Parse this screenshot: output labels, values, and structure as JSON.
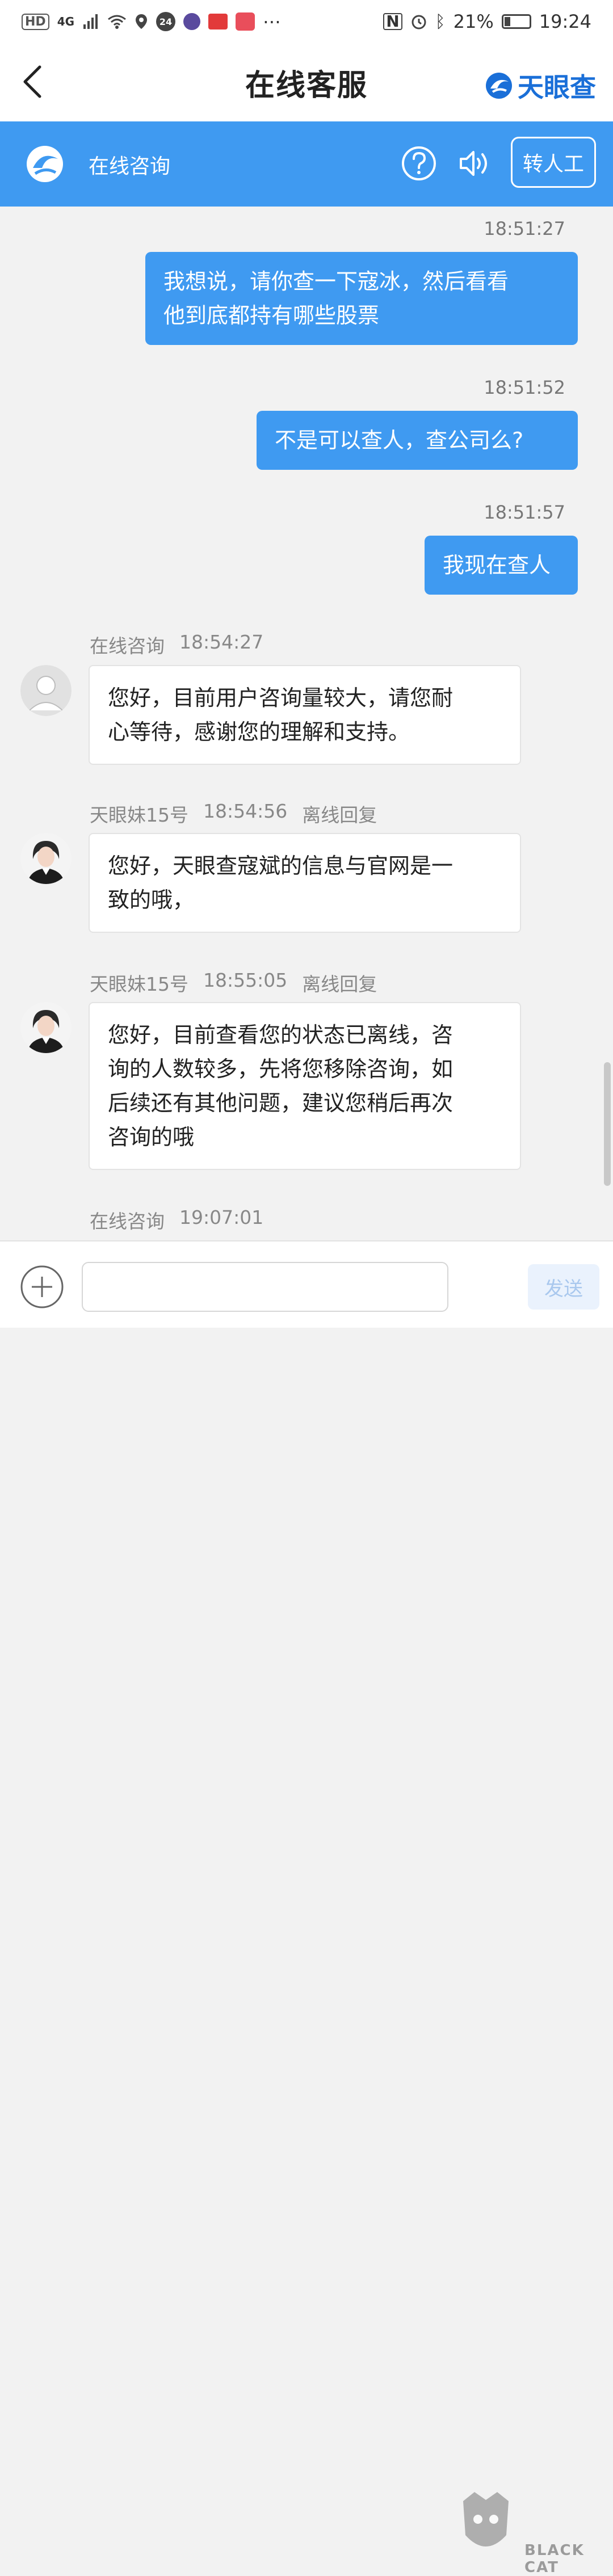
{
  "status_bar": {
    "left_chip": "HD",
    "network": "4G",
    "time_badge": "24",
    "battery": "21%",
    "time": "19:24"
  },
  "header": {
    "title": "在线客服",
    "brand": "天眼查"
  },
  "subbar": {
    "title": "在线咨询",
    "transfer_label": "转人工",
    "bg_color": "#3f9af1"
  },
  "messages": [
    {
      "side": "out",
      "time": "18:51:27",
      "text_lines": [
        "我想说，请你查一下寇冰，然后看看",
        "他到底都持有哪些股票"
      ]
    },
    {
      "side": "out",
      "time": "18:51:52",
      "text_lines": [
        "不是可以查人，查公司么?"
      ]
    },
    {
      "side": "out",
      "time": "18:51:57",
      "text_lines": [
        "我现在查人"
      ]
    },
    {
      "side": "in",
      "sender": "在线咨询",
      "time": "18:54:27",
      "tag": "",
      "avatar": "default-avatar-icon",
      "text_lines": [
        "您好，目前用户咨询量较大，请您耐",
        "心等待，感谢您的理解和支持。"
      ]
    },
    {
      "side": "in",
      "sender": "天眼妹15号",
      "time": "18:54:56",
      "tag": "离线回复",
      "avatar": "agent-avatar",
      "text_lines": [
        "您好，天眼查寇斌的信息与官网是一",
        "致的哦，"
      ]
    },
    {
      "side": "in",
      "sender": "天眼妹15号",
      "time": "18:55:05",
      "tag": "离线回复",
      "avatar": "agent-avatar",
      "text_lines": [
        "您好，目前查看您的状态已离线，咨",
        "询的人数较多，先将您移除咨询，如",
        "后续还有其他问题，建议您稍后再次",
        "咨询的哦"
      ]
    },
    {
      "side": "in",
      "sender": "在线咨询",
      "time": "19:07:01",
      "tag": ""
    }
  ],
  "input": {
    "value": "",
    "placeholder": "",
    "send_label": "发送"
  },
  "watermark": {
    "text": "BLACK CAT"
  }
}
